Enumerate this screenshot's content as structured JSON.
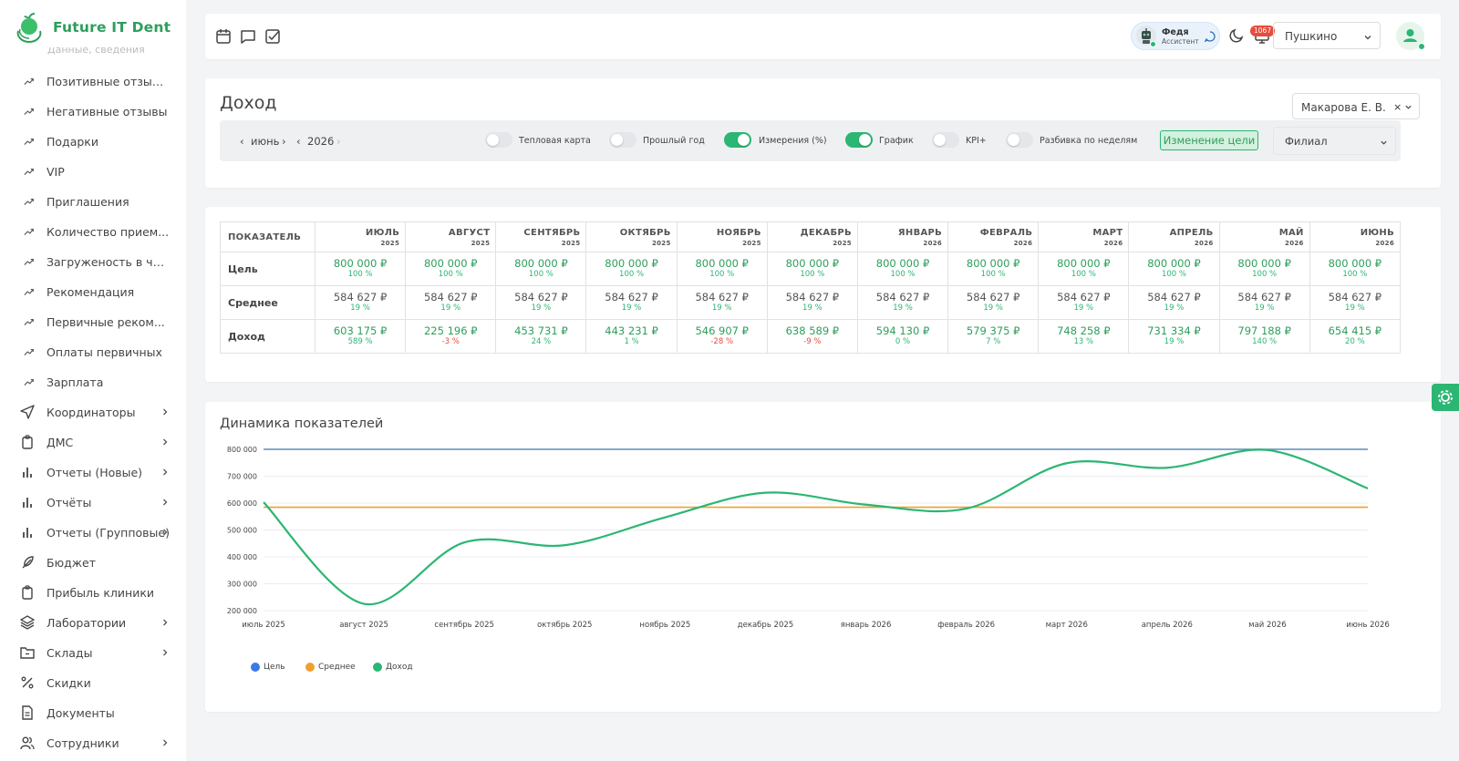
{
  "brand": {
    "name": "Future IT Dent"
  },
  "sidebar": {
    "cutoff_text": "Данные, сведения",
    "items": [
      {
        "label": "Позитивные отзыв...",
        "icon": "trend-icon",
        "sub": true
      },
      {
        "label": "Негативные отзывы",
        "icon": "trend-icon",
        "sub": true
      },
      {
        "label": "Подарки",
        "icon": "trend-icon",
        "sub": true
      },
      {
        "label": "VIP",
        "icon": "trend-icon",
        "sub": true
      },
      {
        "label": "Приглашения",
        "icon": "trend-icon",
        "sub": true
      },
      {
        "label": "Количество прием...",
        "icon": "trend-icon",
        "sub": true
      },
      {
        "label": "Загруженость в ча...",
        "icon": "trend-icon",
        "sub": true
      },
      {
        "label": "Рекомендация",
        "icon": "trend-icon",
        "sub": true
      },
      {
        "label": "Первичные реком...",
        "icon": "trend-icon",
        "sub": true
      },
      {
        "label": "Оплаты первичных",
        "icon": "trend-icon",
        "sub": true
      },
      {
        "label": "Зарплата",
        "icon": "trend-icon",
        "sub": true
      },
      {
        "label": "Координаторы",
        "icon": "send-icon",
        "chevron": true
      },
      {
        "label": "ДМС",
        "icon": "clipboard-icon",
        "chevron": true
      },
      {
        "label": "Отчеты (Новые)",
        "icon": "bar-chart-icon",
        "chevron": true
      },
      {
        "label": "Отчёты",
        "icon": "bar-chart-icon",
        "chevron": true
      },
      {
        "label": "Отчеты (Групповые)",
        "icon": "bar-chart-icon",
        "chevron": true
      },
      {
        "label": "Бюджет",
        "icon": "feather-icon",
        "chevron": false
      },
      {
        "label": "Прибыль клиники",
        "icon": "clipboard-icon",
        "chevron": false
      },
      {
        "label": "Лаборатории",
        "icon": "layers-icon",
        "chevron": true
      },
      {
        "label": "Склады",
        "icon": "folder-icon",
        "chevron": true
      },
      {
        "label": "Скидки",
        "icon": "percent-icon",
        "chevron": false
      },
      {
        "label": "Документы",
        "icon": "document-icon",
        "chevron": false
      },
      {
        "label": "Сотрудники",
        "icon": "users-icon",
        "chevron": true
      }
    ]
  },
  "topbar": {
    "assistant_name": "Федя",
    "assistant_role": "Ассистент",
    "notifications_count": "1067",
    "branch": "Пушкино"
  },
  "header": {
    "title": "Доход",
    "doctor": "Макарова Е. В.",
    "doctor_clear": "×",
    "month": "июнь",
    "year": "2026",
    "toggles": [
      {
        "label": "Тепловая карта",
        "on": false
      },
      {
        "label": "Прошлый год",
        "on": false
      },
      {
        "label": "Измерения (%)",
        "on": true
      },
      {
        "label": "График",
        "on": true
      },
      {
        "label": "KPI+",
        "on": false
      },
      {
        "label": "Разбивка по неделям",
        "on": false
      }
    ],
    "goal_button": "Изменение цели",
    "filial_placeholder": "Филиал"
  },
  "table": {
    "header_label": "ПОКАЗАТЕЛЬ",
    "columns": [
      {
        "month": "ИЮЛЬ",
        "year": "2025"
      },
      {
        "month": "АВГУСТ",
        "year": "2025"
      },
      {
        "month": "СЕНТЯБРЬ",
        "year": "2025"
      },
      {
        "month": "ОКТЯБРЬ",
        "year": "2025"
      },
      {
        "month": "НОЯБРЬ",
        "year": "2025"
      },
      {
        "month": "ДЕКАБРЬ",
        "year": "2025"
      },
      {
        "month": "ЯНВАРЬ",
        "year": "2026"
      },
      {
        "month": "ФЕВРАЛЬ",
        "year": "2026"
      },
      {
        "month": "МАРТ",
        "year": "2026"
      },
      {
        "month": "АПРЕЛЬ",
        "year": "2026"
      },
      {
        "month": "МАЙ",
        "year": "2026"
      },
      {
        "month": "ИЮНЬ",
        "year": "2026"
      }
    ],
    "rows": [
      {
        "label": "Цель",
        "style": "g",
        "cells": [
          {
            "v": "800 000 ₽",
            "p": "100 %"
          },
          {
            "v": "800 000 ₽",
            "p": "100 %"
          },
          {
            "v": "800 000 ₽",
            "p": "100 %"
          },
          {
            "v": "800 000 ₽",
            "p": "100 %"
          },
          {
            "v": "800 000 ₽",
            "p": "100 %"
          },
          {
            "v": "800 000 ₽",
            "p": "100 %"
          },
          {
            "v": "800 000 ₽",
            "p": "100 %"
          },
          {
            "v": "800 000 ₽",
            "p": "100 %"
          },
          {
            "v": "800 000 ₽",
            "p": "100 %"
          },
          {
            "v": "800 000 ₽",
            "p": "100 %"
          },
          {
            "v": "800 000 ₽",
            "p": "100 %"
          },
          {
            "v": "800 000 ₽",
            "p": "100 %"
          }
        ]
      },
      {
        "label": "Среднее",
        "style": "d",
        "cells": [
          {
            "v": "584 627 ₽",
            "p": "19 %"
          },
          {
            "v": "584 627 ₽",
            "p": "19 %"
          },
          {
            "v": "584 627 ₽",
            "p": "19 %"
          },
          {
            "v": "584 627 ₽",
            "p": "19 %"
          },
          {
            "v": "584 627 ₽",
            "p": "19 %"
          },
          {
            "v": "584 627 ₽",
            "p": "19 %"
          },
          {
            "v": "584 627 ₽",
            "p": "19 %"
          },
          {
            "v": "584 627 ₽",
            "p": "19 %"
          },
          {
            "v": "584 627 ₽",
            "p": "19 %"
          },
          {
            "v": "584 627 ₽",
            "p": "19 %"
          },
          {
            "v": "584 627 ₽",
            "p": "19 %"
          },
          {
            "v": "584 627 ₽",
            "p": "19 %"
          }
        ]
      },
      {
        "label": "Доход",
        "style": "g",
        "cells": [
          {
            "v": "603 175 ₽",
            "p": "589 %"
          },
          {
            "v": "225 196 ₽",
            "p": "-3 %",
            "neg": true
          },
          {
            "v": "453 731 ₽",
            "p": "24 %"
          },
          {
            "v": "443 231 ₽",
            "p": "1 %"
          },
          {
            "v": "546 907 ₽",
            "p": "-28 %",
            "neg": true
          },
          {
            "v": "638 589 ₽",
            "p": "-9 %",
            "neg": true
          },
          {
            "v": "594 130 ₽",
            "p": "0 %"
          },
          {
            "v": "579 375 ₽",
            "p": "7 %"
          },
          {
            "v": "748 258 ₽",
            "p": "13 %"
          },
          {
            "v": "731 334 ₽",
            "p": "19 %"
          },
          {
            "v": "797 188 ₽",
            "p": "140 %"
          },
          {
            "v": "654 415 ₽",
            "p": "20 %"
          }
        ]
      }
    ]
  },
  "chart_section": {
    "title": "Динамика показателей"
  },
  "chart_data": {
    "type": "line",
    "categories": [
      "июль 2025",
      "август 2025",
      "сентябрь 2025",
      "октябрь 2025",
      "ноябрь 2025",
      "декабрь 2025",
      "январь 2026",
      "февраль 2026",
      "март 2026",
      "апрель 2026",
      "май 2026",
      "июнь 2026"
    ],
    "ylim": [
      200000,
      800000
    ],
    "yticks": [
      "200 000",
      "300 000",
      "400 000",
      "500 000",
      "600 000",
      "700 000",
      "800 000"
    ],
    "grid": true,
    "legend_position": "bottom-left",
    "series": [
      {
        "name": "Цель",
        "color": "#5b8db8",
        "values": [
          800000,
          800000,
          800000,
          800000,
          800000,
          800000,
          800000,
          800000,
          800000,
          800000,
          800000,
          800000
        ]
      },
      {
        "name": "Среднее",
        "color": "#f0a030",
        "values": [
          584627,
          584627,
          584627,
          584627,
          584627,
          584627,
          584627,
          584627,
          584627,
          584627,
          584627,
          584627
        ]
      },
      {
        "name": "Доход",
        "color": "#2bb673",
        "values": [
          603175,
          225196,
          453731,
          443231,
          546907,
          638589,
          594130,
          579375,
          748258,
          731334,
          797188,
          654415
        ]
      }
    ],
    "legend_colors": [
      "#3b78e7",
      "#f0a030",
      "#2bb673"
    ]
  }
}
